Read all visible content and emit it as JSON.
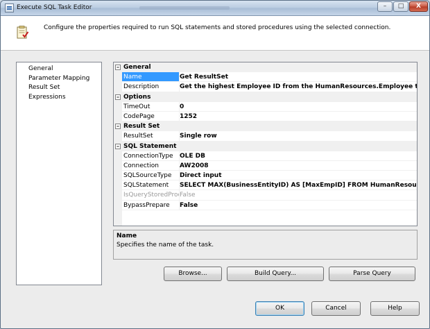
{
  "window": {
    "title": "Execute SQL Task Editor"
  },
  "title_buttons": {
    "minimize": "–",
    "maximize": "□",
    "close": "X"
  },
  "header": {
    "description": "Configure the properties required to run SQL statements and stored procedures using the selected connection."
  },
  "nav": {
    "items": [
      {
        "label": "General"
      },
      {
        "label": "Parameter Mapping"
      },
      {
        "label": "Result Set"
      },
      {
        "label": "Expressions"
      }
    ]
  },
  "grid": {
    "categories": [
      {
        "label": "General",
        "toggle": "–",
        "rows": [
          {
            "name": "Name",
            "value": "Get ResultSet"
          },
          {
            "name": "Description",
            "value": "Get the highest Employee ID from the HumanResources.Employee table"
          }
        ]
      },
      {
        "label": "Options",
        "toggle": "–",
        "rows": [
          {
            "name": "TimeOut",
            "value": "0"
          },
          {
            "name": "CodePage",
            "value": "1252"
          }
        ]
      },
      {
        "label": "Result Set",
        "toggle": "–",
        "rows": [
          {
            "name": "ResultSet",
            "value": "Single row"
          }
        ]
      },
      {
        "label": "SQL Statement",
        "toggle": "–",
        "rows": [
          {
            "name": "ConnectionType",
            "value": "OLE DB"
          },
          {
            "name": "Connection",
            "value": "AW2008"
          },
          {
            "name": "SQLSourceType",
            "value": "Direct input"
          },
          {
            "name": "SQLStatement",
            "value": "SELECT MAX(BusinessEntityID) AS [MaxEmpID] FROM HumanResources.Employee"
          },
          {
            "name": "IsQueryStoredProce",
            "value": "False"
          },
          {
            "name": "BypassPrepare",
            "value": "False"
          }
        ]
      }
    ]
  },
  "help": {
    "title": "Name",
    "text": "Specifies the name of the task."
  },
  "buttons": {
    "browse": "Browse...",
    "build_query": "Build Query...",
    "parse_query": "Parse Query",
    "ok": "OK",
    "cancel": "Cancel",
    "help": "Help"
  },
  "colors": {
    "selection": "#3399ff",
    "category_bg": "#f0f0f0",
    "dim_text": "#9a9a9a"
  }
}
